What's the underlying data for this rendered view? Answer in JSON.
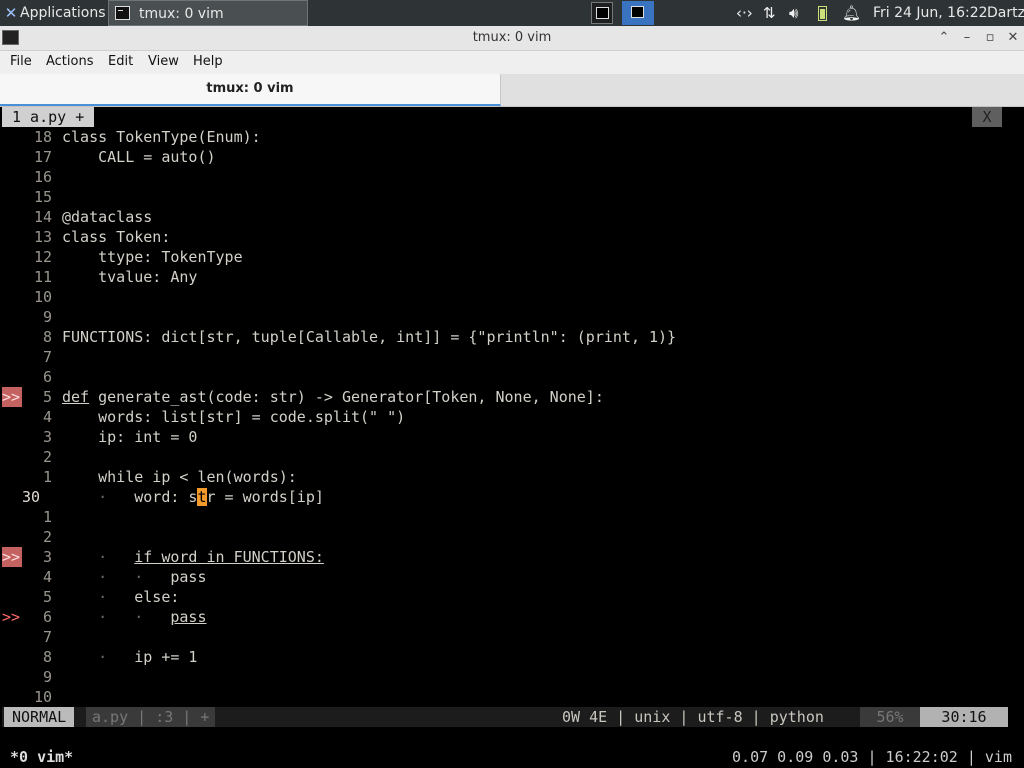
{
  "panel": {
    "applications_label": "Applications",
    "task_title": "tmux: 0 vim",
    "clock": "Fri 24 Jun, 16:22",
    "user": "Dartz",
    "tray_icons": [
      "network-icon",
      "transfer-icon",
      "volume-icon",
      "battery-icon",
      "bell-icon"
    ]
  },
  "window": {
    "title": "tmux: 0 vim",
    "minimize": "⌃",
    "restore": "–",
    "maximize": "▫",
    "close": "✕"
  },
  "menubar": {
    "items": [
      "File",
      "Actions",
      "Edit",
      "View",
      "Help"
    ]
  },
  "tabbar": {
    "tab_label": "tmux: 0 vim"
  },
  "vim": {
    "buffer_tab": "1 a.py +",
    "close_tab": "X",
    "lines": [
      {
        "num": "18",
        "sign": "",
        "code": "class TokenType(Enum):"
      },
      {
        "num": "17",
        "sign": "",
        "code": "    CALL = auto()"
      },
      {
        "num": "16",
        "sign": "",
        "code": ""
      },
      {
        "num": "15",
        "sign": "",
        "code": ""
      },
      {
        "num": "14",
        "sign": "",
        "code": "@dataclass"
      },
      {
        "num": "13",
        "sign": "",
        "code": "class Token:"
      },
      {
        "num": "12",
        "sign": "",
        "code": "    ttype: TokenType"
      },
      {
        "num": "11",
        "sign": "",
        "code": "    tvalue: Any"
      },
      {
        "num": "10",
        "sign": "",
        "code": ""
      },
      {
        "num": "9",
        "sign": "",
        "code": ""
      },
      {
        "num": "8",
        "sign": "",
        "code": "FUNCTIONS: dict[str, tuple[Callable, int]] = {\"println\": (print, 1)}"
      },
      {
        "num": "7",
        "sign": "",
        "code": ""
      },
      {
        "num": "6",
        "sign": "",
        "code": ""
      },
      {
        "num": "5",
        "sign": ">>",
        "code": "def generate_ast(code: str) -> Generator[Token, None, None]:"
      },
      {
        "num": "4",
        "sign": "",
        "code": "    words: list[str] = code.split(\" \")"
      },
      {
        "num": "3",
        "sign": "",
        "code": "    ip: int = 0"
      },
      {
        "num": "2",
        "sign": "",
        "code": ""
      },
      {
        "num": "1",
        "sign": "",
        "code": "    while ip < len(words):"
      },
      {
        "num": "30",
        "sign": "",
        "code": "    ·   word: str = words[ip]"
      },
      {
        "num": "1",
        "sign": "",
        "code": ""
      },
      {
        "num": "2",
        "sign": "",
        "code": ""
      },
      {
        "num": "3",
        "sign": ">>",
        "code": "    ·   if word in FUNCTIONS:"
      },
      {
        "num": "4",
        "sign": "",
        "code": "    ·   ·   pass"
      },
      {
        "num": "5",
        "sign": "",
        "code": "    ·   else:"
      },
      {
        "num": "6",
        "sign": ">>",
        "code": "    ·   ·   pass"
      },
      {
        "num": "7",
        "sign": "",
        "code": ""
      },
      {
        "num": "8",
        "sign": "",
        "code": "    ·   ip += 1"
      },
      {
        "num": "9",
        "sign": "",
        "code": ""
      },
      {
        "num": "10",
        "sign": "",
        "code": ""
      }
    ],
    "status": {
      "mode": "NORMAL",
      "file_segment": "a.py | :3 | +",
      "right_info": "0W 4E | unix | utf-8 | python",
      "percent": "56%",
      "position": "30:16"
    }
  },
  "tmux": {
    "window_list": "*0 vim*",
    "right_status": "0.07 0.09 0.03 | 16:22:02 | vim"
  },
  "colors": {
    "accent": "#3a74c0",
    "cursor": "#f49a2a",
    "error_sign": "#c46262"
  }
}
